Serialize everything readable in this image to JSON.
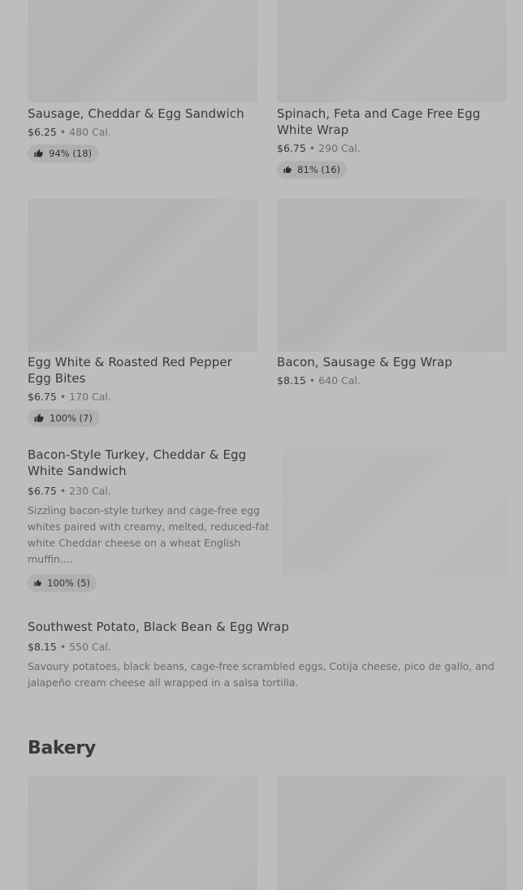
{
  "items": [
    {
      "name": "Sausage, Cheddar & Egg Sandwich",
      "price": "$6.25",
      "calories": "480 Cal.",
      "rating": "94% (18)"
    },
    {
      "name": "Spinach, Feta and Cage Free Egg White Wrap",
      "price": "$6.75",
      "calories": "290 Cal.",
      "rating": "81% (16)"
    },
    {
      "name": "Egg White & Roasted Red Pepper Egg Bites",
      "price": "$6.75",
      "calories": "170 Cal.",
      "rating": "100% (7)"
    },
    {
      "name": "Bacon, Sausage & Egg Wrap",
      "price": "$8.15",
      "calories": "640 Cal."
    },
    {
      "name": "Bacon-Style Turkey, Cheddar & Egg White Sandwich",
      "price": "$6.75",
      "calories": "230 Cal.",
      "description": "Sizzling bacon-style turkey and cage-free egg whites paired with creamy, melted, reduced-fat white Cheddar cheese on a wheat English muffin....",
      "rating": "100% (5)"
    },
    {
      "name": "Southwest Potato, Black Bean & Egg Wrap",
      "price": "$8.15",
      "calories": "550 Cal.",
      "description": "Savoury potatoes, black beans, cage-free scrambled eggs, Cotija cheese, pico de gallo, and jalapeño cream cheese all wrapped in a salsa tortilla."
    }
  ],
  "separator": "•",
  "sections": {
    "bakery_title": "Bakery"
  },
  "icons": {
    "rating": "thumbs-up-icon"
  }
}
